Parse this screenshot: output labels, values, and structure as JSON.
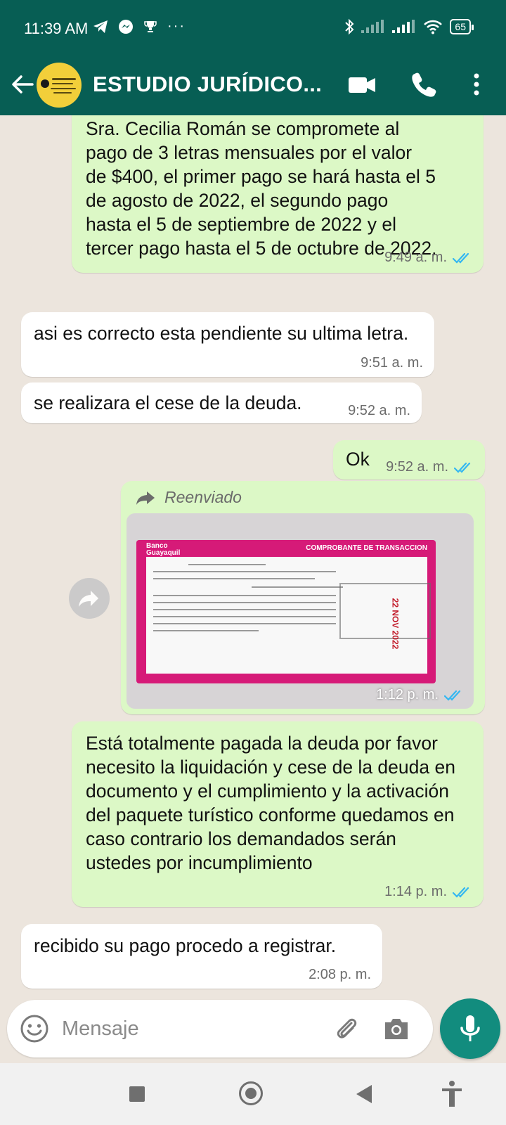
{
  "status_bar": {
    "time": "11:39 AM",
    "battery": "65"
  },
  "header": {
    "contact_name": "ESTUDIO JURÍDICO..."
  },
  "messages": [
    {
      "direction": "outgoing",
      "text": "Sra. Cecilia Román se compromete al pago de 3 letras mensuales por el valor de $400, el primer pago se hará hasta el 5 de agosto de 2022, el segundo pago hasta el 5 de septiembre de 2022 y el tercer pago hasta el 5 de octubre de 2022.",
      "time": "9:49 a. m.",
      "read": true
    },
    {
      "direction": "incoming",
      "text": "asi es correcto esta pendiente su ultima letra.",
      "time": "9:51 a. m."
    },
    {
      "direction": "incoming",
      "text": "se realizara el cese de la deuda.",
      "time": "9:52 a. m."
    },
    {
      "direction": "outgoing",
      "text": "Ok",
      "time": "9:52 a. m.",
      "read": true
    },
    {
      "direction": "outgoing",
      "forwarded_label": "Reenviado",
      "type": "image",
      "time": "1:12 p. m.",
      "read": true,
      "receipt": {
        "bank": "Banco Guayaquil",
        "title": "COMPROBANTE DE TRANSACCION",
        "stamp_date": "22 NOV 2022"
      }
    },
    {
      "direction": "outgoing",
      "text": "Está totalmente pagada la deuda por favor necesito la liquidación y cese de la deuda en documento y el cumplimiento y la activación del paquete turístico conforme quedamos en caso contrario los demandados serán ustedes por incumplimiento",
      "time": "1:14 p. m.",
      "read": true
    },
    {
      "direction": "incoming",
      "text": "recibido su pago procedo a registrar.",
      "time": "2:08 p. m."
    }
  ],
  "input": {
    "placeholder": "Mensaje"
  },
  "colors": {
    "header": "#075e54",
    "outgoing_bubble": "#dcf8c6",
    "incoming_bubble": "#ffffff",
    "read_ticks": "#34b7f1",
    "mic_button": "#128c7e"
  }
}
